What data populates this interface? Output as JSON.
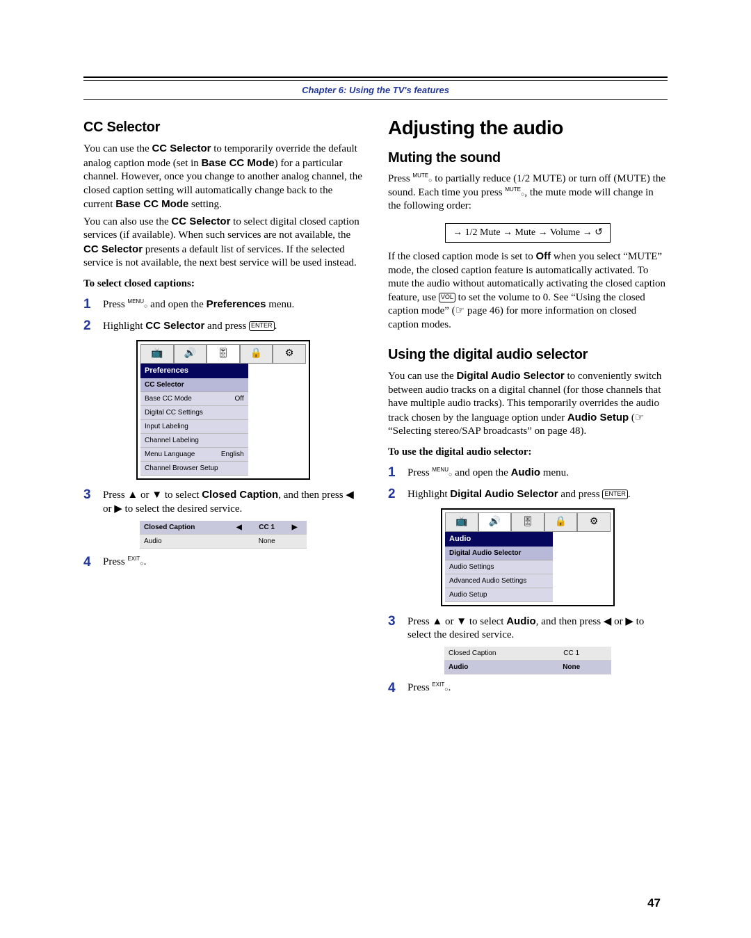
{
  "chapter": "Chapter 6: Using the TV's features",
  "left": {
    "h2": "CC Selector",
    "p1a": "You can use the ",
    "p1b": "CC Selector",
    "p1c": " to temporarily override the default analog caption mode (set in ",
    "p1d": "Base CC Mode",
    "p1e": ") for a particular channel. However, once you change to another analog channel, the closed caption setting will automatically change back to the current ",
    "p1f": "Base CC Mode",
    "p1g": " setting.",
    "p2a": "You can also use the ",
    "p2b": "CC Selector",
    "p2c": " to select digital closed caption services (if available). When such services are not available, the ",
    "p2d": "CC Selector",
    "p2e": " presents a default list of services. If the selected service is not available, the next best service will be used instead.",
    "sub": "To select closed captions:",
    "s1a": "Press ",
    "s1b": " and open the ",
    "s1c": "Preferences",
    "s1d": " menu.",
    "s2a": "Highlight ",
    "s2b": "CC Selector",
    "s2c": " and press ",
    "menu": {
      "title": "Preferences",
      "highlight": "CC Selector",
      "rows": [
        {
          "l": "Base CC Mode",
          "r": "Off"
        },
        {
          "l": "Digital CC Settings",
          "r": ""
        },
        {
          "l": "Input Labeling",
          "r": ""
        },
        {
          "l": "Channel Labeling",
          "r": ""
        },
        {
          "l": "Menu Language",
          "r": "English"
        },
        {
          "l": "Channel Browser Setup",
          "r": ""
        }
      ]
    },
    "s3a": "Press ",
    "s3b": " or ",
    "s3c": " to select ",
    "s3d": "Closed Caption",
    "s3e": ", and then press ",
    "s3f": " or ",
    "s3g": " to select the desired service.",
    "opt": {
      "sel": {
        "l": "Closed Caption",
        "v": "CC 1"
      },
      "row": {
        "l": "Audio",
        "v": "None"
      }
    },
    "s4a": "Press "
  },
  "right": {
    "h1": "Adjusting the audio",
    "h2a": "Muting the sound",
    "m1a": "Press ",
    "m1b": " to partially reduce (1/2 MUTE) or turn off (MUTE) the sound. Each time you press ",
    "m1c": ", the mute mode will change in the following order:",
    "flow": "1/2 Mute → Mute → Volume",
    "m2a": "If the closed caption mode is set to ",
    "m2b": "Off",
    "m2c": " when you select “MUTE” mode, the closed caption feature is automatically activated. To mute the audio without automatically activating the closed caption feature, use ",
    "m2d": " to set the volume to 0. See “Using the closed caption mode” (",
    "m2e": " page 46) for more information on closed caption modes.",
    "h2b": "Using the digital audio selector",
    "d1a": "You can use the ",
    "d1b": "Digital Audio Selector",
    "d1c": " to conveniently switch between audio tracks on a digital channel (for those channels that have multiple audio tracks). This temporarily overrides the audio track chosen by the language option under ",
    "d1d": "Audio Setup",
    "d1e": " (",
    "d1f": " “Selecting stereo/SAP broadcasts” on page 48).",
    "sub": "To use the digital audio selector:",
    "s1a": "Press ",
    "s1b": " and open the ",
    "s1c": "Audio",
    "s1d": " menu.",
    "s2a": "Highlight ",
    "s2b": "Digital Audio Selector",
    "s2c": " and press ",
    "menu": {
      "title": "Audio",
      "highlight": "Digital Audio Selector",
      "rows": [
        {
          "l": "Audio Settings",
          "r": ""
        },
        {
          "l": "Advanced Audio Settings",
          "r": ""
        },
        {
          "l": "Audio Setup",
          "r": ""
        }
      ]
    },
    "s3a": "Press ",
    "s3b": " or ",
    "s3c": " to select ",
    "s3d": "Audio",
    "s3e": ", and then press ",
    "s3f": " or ",
    "s3g": " to select the desired service.",
    "opt": {
      "row": {
        "l": "Closed Caption",
        "v": "CC 1"
      },
      "sel": {
        "l": "Audio",
        "v": "None"
      }
    },
    "s4a": "Press "
  },
  "labels": {
    "menu_sup": "MENU",
    "exit_sup": "EXIT",
    "mute_sup": "MUTE",
    "enter": "ENTER",
    "vol": "VOL",
    "circle": "○",
    "up": "▲",
    "down": "▼",
    "left": "◀",
    "right": "▶",
    "hand": "☞",
    "dot": "."
  },
  "page_num": "47"
}
